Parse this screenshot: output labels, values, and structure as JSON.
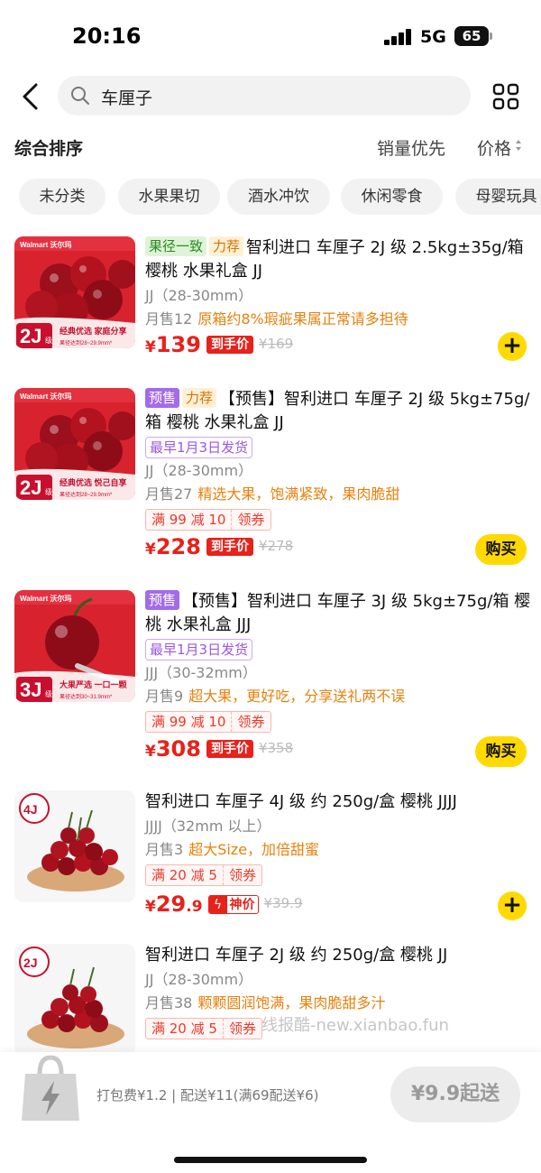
{
  "status_bar": {
    "time": "20:16",
    "network": "5G",
    "battery": "65"
  },
  "search": {
    "query": "车厘子"
  },
  "sort": {
    "default": "综合排序",
    "sales": "销量优先",
    "price": "价格"
  },
  "categories": [
    "未分类",
    "水果果切",
    "酒水冲饮",
    "休闲零食",
    "母婴玩具"
  ],
  "products": [
    {
      "badges": [
        "果径一致",
        "力荐"
      ],
      "title": "智利进口 车厘子 2J 级 2.5kg±35g/箱 樱桃 水果礼盒 JJ",
      "spec": "JJ（28-30mm）",
      "sales": "月售12",
      "slogan": "原箱约8%瑕疵果属正常请多担待",
      "price": "139",
      "price_tag": "到手价",
      "old_price": "¥169",
      "action": "+",
      "thumb": {
        "grade": "2J",
        "grade_suffix": "级",
        "brand": "Walmart 沃尔玛",
        "line1": "经典优选 家庭分享",
        "line2": "果径达到28~29.9mm*"
      }
    },
    {
      "badges": [
        "预售",
        "力荐"
      ],
      "title": "【预售】智利进口 车厘子 2J 级 5kg±75g/箱 樱桃 水果礼盒 JJ",
      "ship": "最早1月3日发货",
      "spec": "JJ（28-30mm）",
      "sales": "月售27",
      "slogan": "精选大果，饱满紧致，果肉脆甜",
      "coupon": "满 99 减 10",
      "coupon_claim": "领券",
      "price": "228",
      "price_tag": "到手价",
      "old_price": "¥278",
      "action": "购买",
      "thumb": {
        "grade": "2J",
        "grade_suffix": "级",
        "brand": "Walmart 沃尔玛",
        "line1": "经典优选 悦己自享",
        "line2": "果径达到28~29.9mm*"
      }
    },
    {
      "badges": [
        "预售"
      ],
      "title": "【预售】智利进口 车厘子 3J 级 5kg±75g/箱 樱桃 水果礼盒 JJJ",
      "ship": "最早1月3日发货",
      "spec": "JJJ（30-32mm）",
      "sales": "月售9",
      "slogan": "超大果，更好吃，分享送礼两不误",
      "coupon": "满 99 减 10",
      "coupon_claim": "领券",
      "price": "308",
      "price_tag": "到手价",
      "old_price": "¥358",
      "action": "购买",
      "thumb": {
        "grade": "3J",
        "grade_suffix": "级",
        "brand": "Walmart 沃尔玛",
        "line1": "大果严选 一口一颗",
        "line2": "果径达到30~31.9mm*"
      }
    },
    {
      "badges": [],
      "title": "智利进口 车厘子 4J 级 约 250g/盒 樱桃 JJJJ",
      "spec": "JJJJ（32mm 以上）",
      "sales": "月售3",
      "slogan": "超大Size，加倍甜蜜",
      "coupon": "满 20 减 5",
      "coupon_claim": "领券",
      "price": "29",
      "price_decimal": ".9",
      "price_tag": "神价",
      "old_price": "¥39.9",
      "action": "+",
      "thumb": {
        "grade": "4J"
      }
    },
    {
      "badges": [],
      "title": "智利进口 车厘子 2J 级 约 250g/盒 樱桃 JJ",
      "spec": "JJ（28-30mm）",
      "sales": "月售38",
      "slogan": "颗颗圆润饱满，果肉脆甜多汁",
      "coupon": "满 20 减 5",
      "coupon_claim": "领券",
      "thumb": {
        "grade": "2J"
      }
    }
  ],
  "watermark": "线报酷-new.xianbao.fun",
  "bottom": {
    "fee_text": "打包费¥1.2 | 配送¥11(满69配送¥6)",
    "min_order": "¥9.9起送"
  },
  "colors": {
    "accent": "#ffd900",
    "price_red": "#e8211a",
    "slogan_orange": "#e8800c",
    "presale_purple": "#a36be8"
  },
  "icons": [
    "back-arrow-icon",
    "search-icon",
    "grid-icon",
    "sort-arrows-icon",
    "plus-icon",
    "lightning-bag-icon"
  ]
}
